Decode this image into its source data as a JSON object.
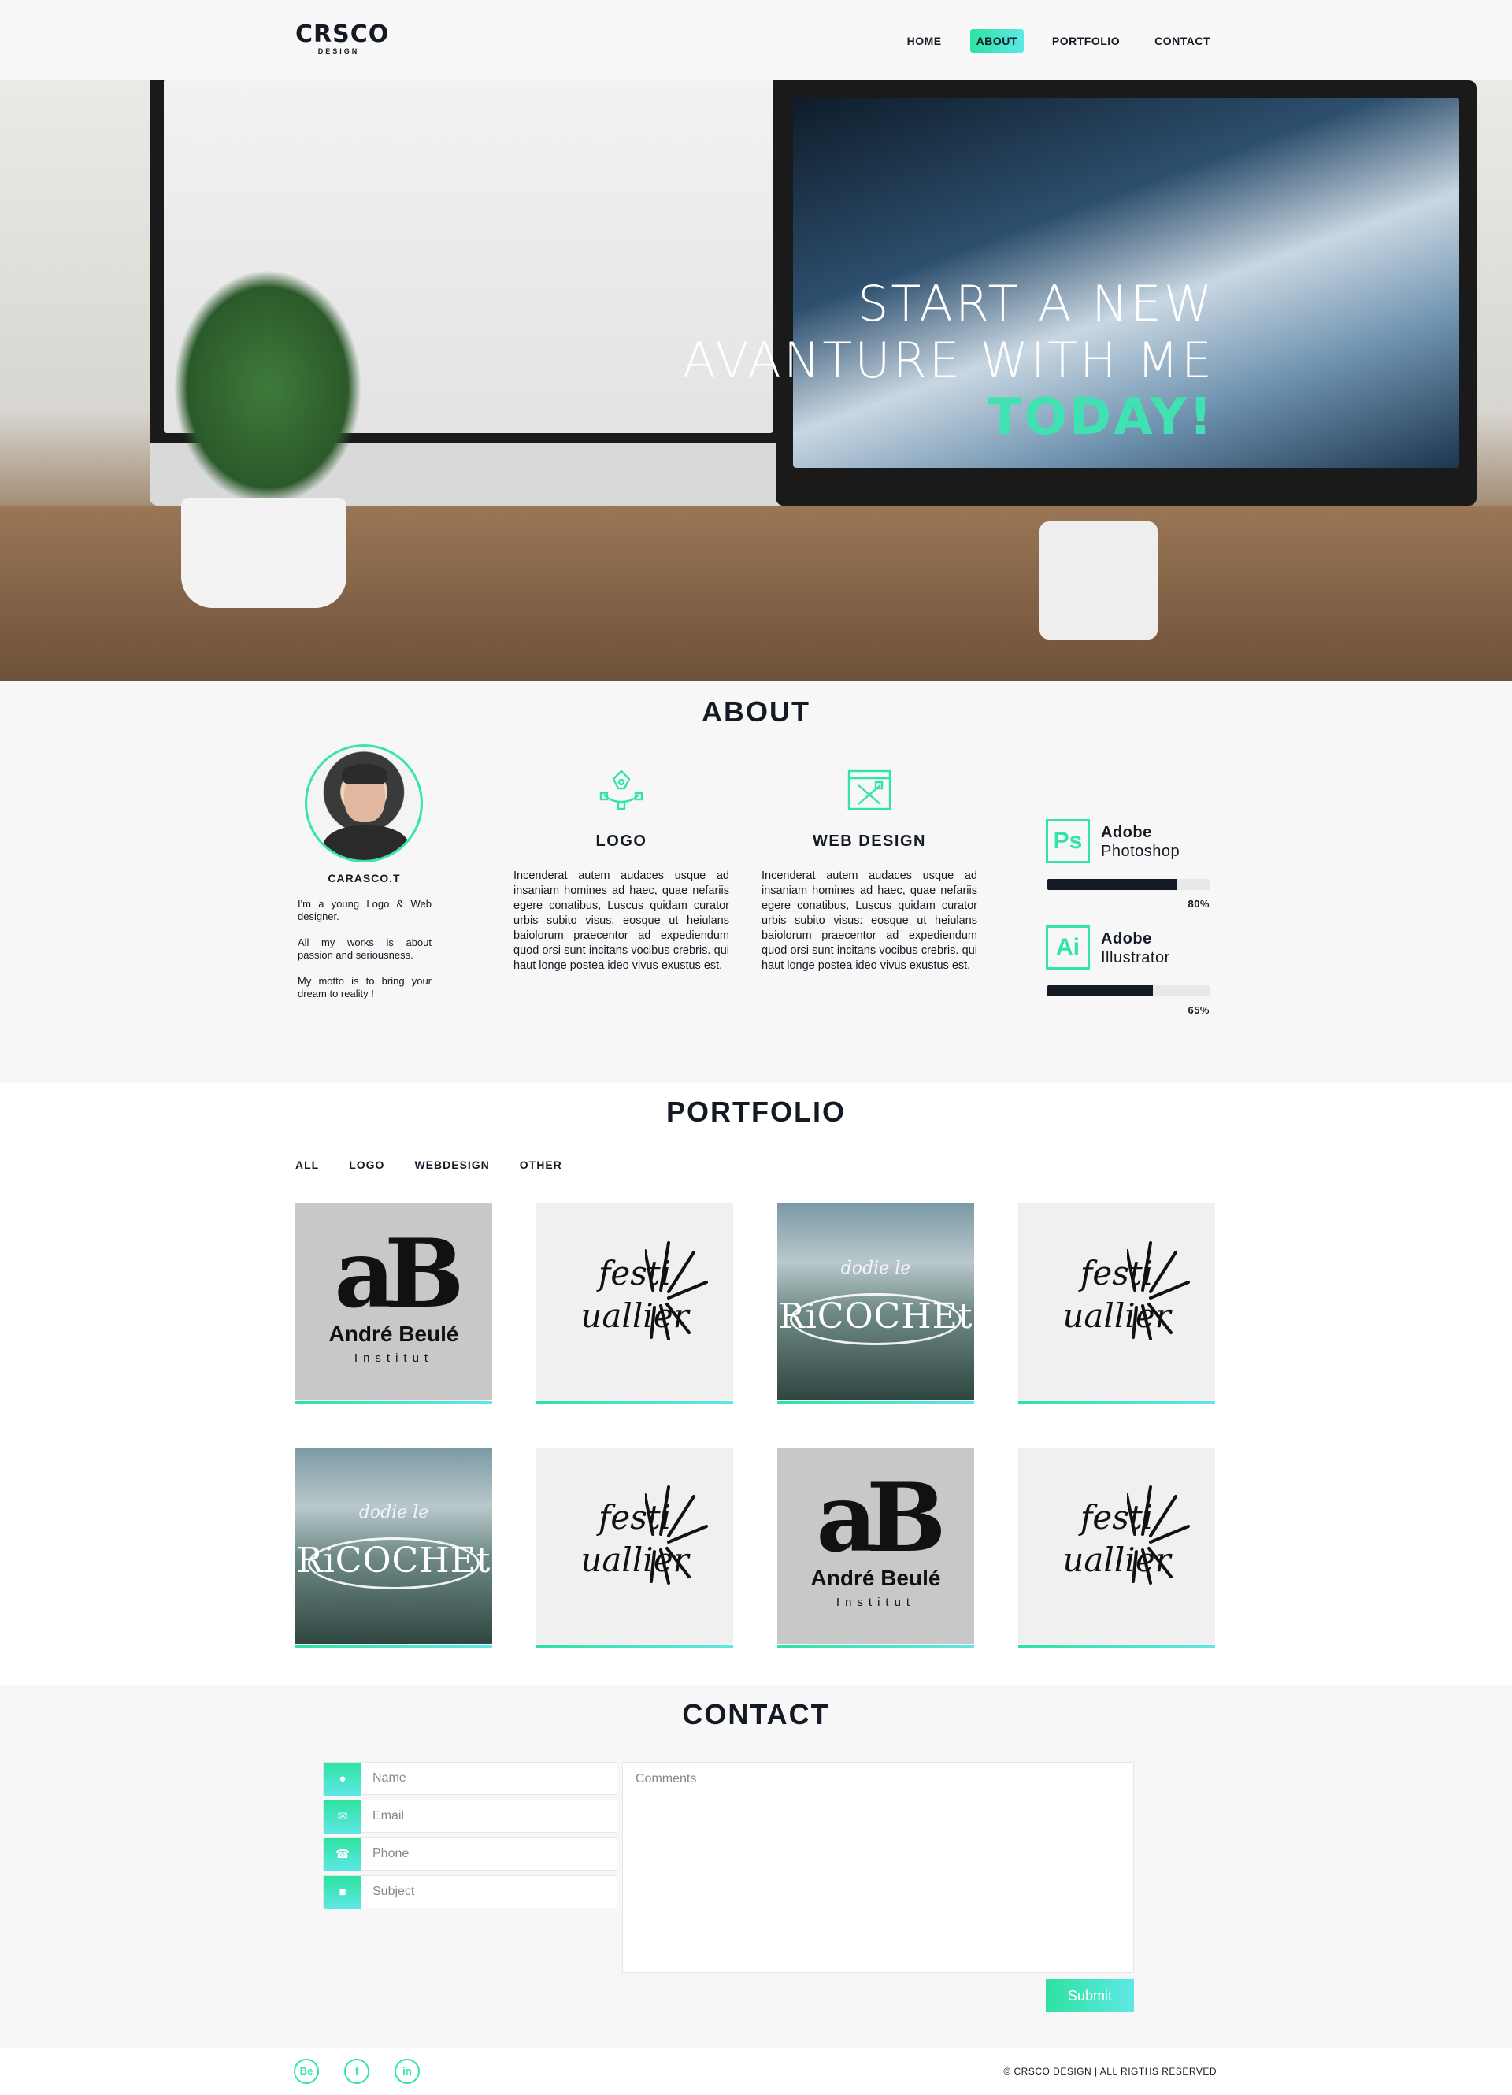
{
  "header": {
    "logo_main": "CRSCO",
    "logo_sub": "DESIGN",
    "nav": [
      {
        "label": "HOME"
      },
      {
        "label": "ABOUT"
      },
      {
        "label": "PORTFOLIO"
      },
      {
        "label": "CONTACT"
      }
    ],
    "active_nav": "ABOUT"
  },
  "hero": {
    "line1": "START A NEW",
    "line2": "AVANTURE WITH ME",
    "line3": "TODAY!"
  },
  "about": {
    "title": "ABOUT",
    "name": "CARASCO.T",
    "bio": [
      "I'm a young Logo & Web designer.",
      "All my works is about passion and seriousness.",
      "My motto is to bring your dream to reality !"
    ],
    "services": [
      {
        "title": "LOGO",
        "icon": "pen-nib-icon",
        "text": "Incenderat autem audaces usque ad insaniam homines ad haec, quae nefariis egere conatibus, Luscus quidam curator urbis subito visus: eosque ut heiulans baiolorum praecentor ad expediendum quod orsi sunt incitans vocibus crebris. qui haut longe postea ideo vivus exustus est."
      },
      {
        "title": "WEB DESIGN",
        "icon": "browser-tools-icon",
        "text": "Incenderat autem audaces usque ad insaniam homines ad haec, quae nefariis egere conatibus, Luscus quidam curator urbis subito visus: eosque ut heiulans baiolorum praecentor ad expediendum quod orsi sunt incitans vocibus crebris. qui haut longe postea ideo vivus exustus est."
      }
    ],
    "skills": [
      {
        "badge": "Ps",
        "name1": "Adobe",
        "name2": "Photoshop",
        "percent": 80,
        "percent_label": "80%"
      },
      {
        "badge": "Ai",
        "name1": "Adobe",
        "name2": "Illustrator",
        "percent": 65,
        "percent_label": "65%"
      }
    ]
  },
  "portfolio": {
    "title": "PORTFOLIO",
    "filters": [
      "ALL",
      "LOGO",
      "WEBDESIGN",
      "OTHER"
    ],
    "tiles": [
      {
        "kind": "ab"
      },
      {
        "kind": "festi"
      },
      {
        "kind": "ricochet"
      },
      {
        "kind": "festi"
      },
      {
        "kind": "ricochet"
      },
      {
        "kind": "festi"
      },
      {
        "kind": "ab"
      },
      {
        "kind": "festi"
      }
    ],
    "ab_mark": "aB",
    "ab_name": "André Beulé",
    "ab_sub": "Institut",
    "festi_text1": "festi",
    "festi_text2": "uallier",
    "ricochet_top": "dodie le",
    "ricochet_text": "RiCOCHEt"
  },
  "contact": {
    "title": "CONTACT",
    "fields": [
      {
        "placeholder": "Name",
        "icon": "user-icon"
      },
      {
        "placeholder": "Email",
        "icon": "envelope-icon"
      },
      {
        "placeholder": "Phone",
        "icon": "phone-icon"
      },
      {
        "placeholder": "Subject",
        "icon": "chat-icon"
      }
    ],
    "comments_placeholder": "Comments",
    "submit_label": "Submit"
  },
  "footer": {
    "social": [
      {
        "label": "Be",
        "icon": "behance-icon"
      },
      {
        "label": "f",
        "icon": "facebook-icon"
      },
      {
        "label": "in",
        "icon": "linkedin-icon"
      }
    ],
    "copyright": "© CRSCO DESIGN | ALL RIGTHS RESERVED"
  },
  "colors": {
    "accent": "#2de3a0",
    "accent_light": "#5ee7e6",
    "dark": "#141a24"
  }
}
